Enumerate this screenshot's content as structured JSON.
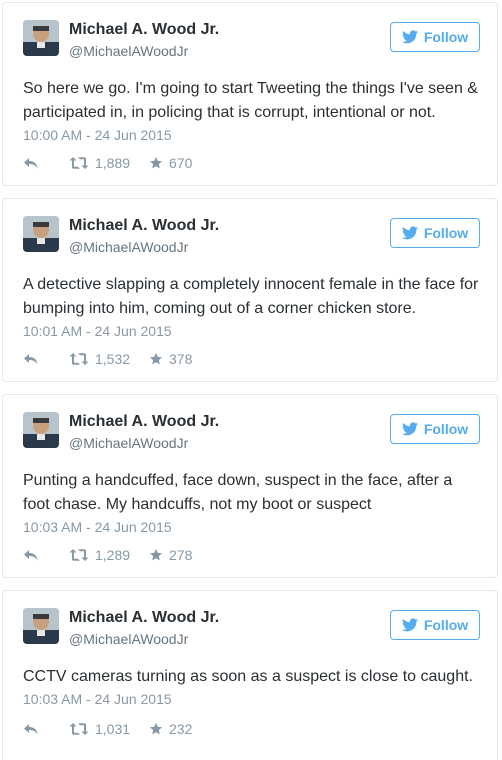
{
  "follow_label": "Follow",
  "tweets": [
    {
      "name": "Michael A. Wood Jr.",
      "handle": "@MichaelAWoodJr",
      "text": "So here we go. I'm going to start Tweeting the things I've seen & participated in, in policing that is corrupt, intentional or not.",
      "timestamp": "10:00 AM - 24 Jun 2015",
      "retweets": "1,889",
      "likes": "670"
    },
    {
      "name": "Michael A. Wood Jr.",
      "handle": "@MichaelAWoodJr",
      "text": "A detective slapping a completely innocent female in the face for bumping into him, coming out of a corner chicken store.",
      "timestamp": "10:01 AM - 24 Jun 2015",
      "retweets": "1,532",
      "likes": "378"
    },
    {
      "name": "Michael A. Wood Jr.",
      "handle": "@MichaelAWoodJr",
      "text": "Punting a handcuffed, face down, suspect in the face, after a foot chase. My handcuffs, not my boot or suspect",
      "timestamp": "10:03 AM - 24 Jun 2015",
      "retweets": "1,289",
      "likes": "278"
    },
    {
      "name": "Michael A. Wood Jr.",
      "handle": "@MichaelAWoodJr",
      "text": "CCTV cameras turning as soon as a suspect is close to caught.",
      "timestamp": "10:03 AM - 24 Jun 2015",
      "retweets": "1,031",
      "likes": "232"
    }
  ],
  "colors": {
    "twitter_blue": "#55acee",
    "meta_gray": "#8899a6",
    "text": "#292f33",
    "border": "#e1e8ed"
  },
  "icons": [
    "bird-icon",
    "reply-icon",
    "retweet-icon",
    "like-star-icon"
  ]
}
